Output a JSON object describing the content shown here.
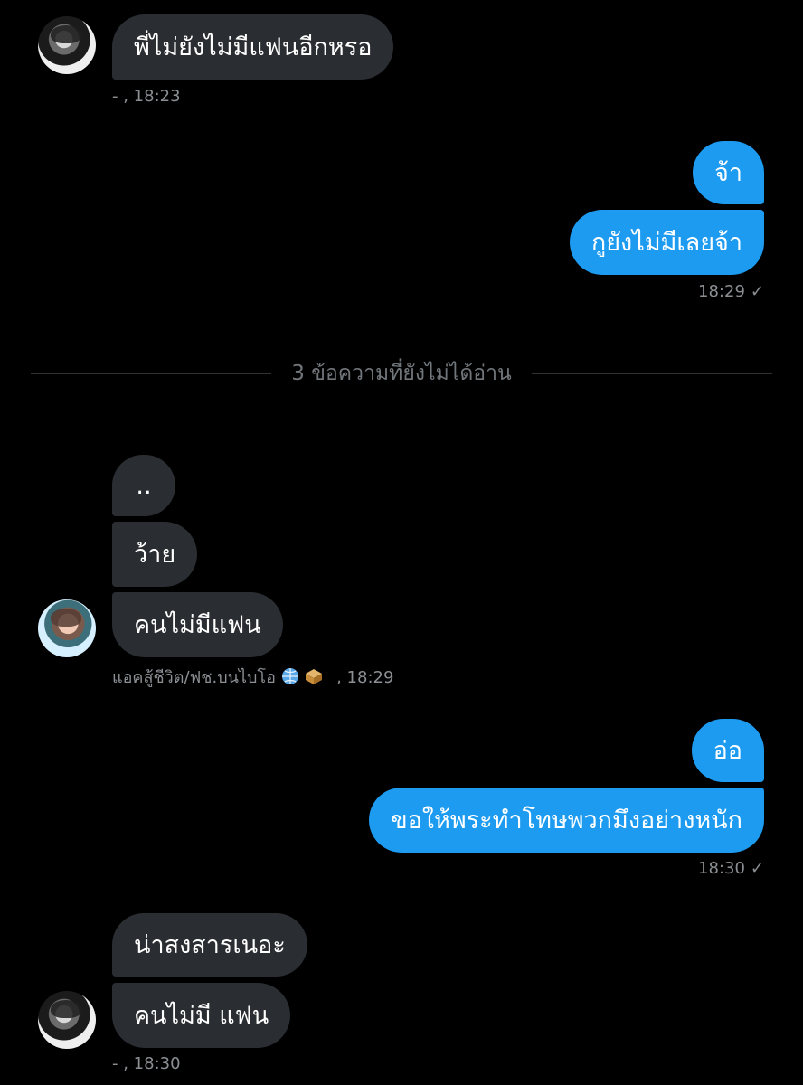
{
  "conversation": {
    "block1": {
      "message": "พี่ไม่ยังไม่มีแฟนอีกหรอ",
      "meta": "- , 18:23"
    },
    "block2": {
      "messages": [
        "จ้า",
        "กูยังไม่มีเลยจ้า"
      ],
      "time": "18:29",
      "status_icon": "check-icon"
    },
    "divider": "3 ข้อความที่ยังไม่ได้อ่าน",
    "block3": {
      "messages": [
        "..",
        "ว้าย",
        "คนไม่มีแฟน"
      ],
      "sender": "แอคสู้ชีวิต/ฟช.บนไบโอ",
      "time": ", 18:29",
      "emoji_icons": [
        "globe-icon",
        "box-icon"
      ]
    },
    "block4": {
      "messages": [
        "อ่อ",
        "ขอให้พระทำโทษพวกมึงอย่างหนัก"
      ],
      "time": "18:30",
      "status_icon": "check-icon"
    },
    "block5": {
      "messages": [
        "น่าสงสารเนอะ",
        "คนไม่มี แฟน"
      ],
      "meta": "- , 18:30"
    }
  },
  "colors": {
    "background": "#000000",
    "incoming_bubble": "#2a2d31",
    "outgoing_bubble": "#1d9bf0",
    "meta_text": "#8b8f93"
  }
}
